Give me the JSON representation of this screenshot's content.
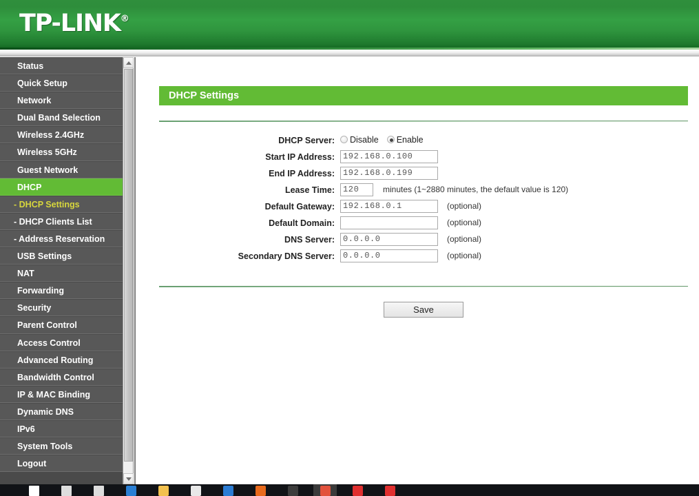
{
  "brand": {
    "name": "TP-LINK",
    "trademark": "®"
  },
  "sidebar": {
    "items": [
      {
        "label": "Status",
        "type": "main",
        "state": "normal"
      },
      {
        "label": "Quick Setup",
        "type": "main",
        "state": "normal"
      },
      {
        "label": "Network",
        "type": "main",
        "state": "normal"
      },
      {
        "label": "Dual Band Selection",
        "type": "main",
        "state": "normal"
      },
      {
        "label": "Wireless 2.4GHz",
        "type": "main",
        "state": "normal"
      },
      {
        "label": "Wireless 5GHz",
        "type": "main",
        "state": "normal"
      },
      {
        "label": "Guest Network",
        "type": "main",
        "state": "normal"
      },
      {
        "label": "DHCP",
        "type": "main",
        "state": "active"
      },
      {
        "label": "- DHCP Settings",
        "type": "sub",
        "state": "current"
      },
      {
        "label": "- DHCP Clients List",
        "type": "sub",
        "state": "normal"
      },
      {
        "label": "- Address Reservation",
        "type": "sub",
        "state": "normal"
      },
      {
        "label": "USB Settings",
        "type": "main",
        "state": "normal"
      },
      {
        "label": "NAT",
        "type": "main",
        "state": "normal"
      },
      {
        "label": "Forwarding",
        "type": "main",
        "state": "normal"
      },
      {
        "label": "Security",
        "type": "main",
        "state": "normal"
      },
      {
        "label": "Parent Control",
        "type": "main",
        "state": "normal"
      },
      {
        "label": "Access Control",
        "type": "main",
        "state": "normal"
      },
      {
        "label": "Advanced Routing",
        "type": "main",
        "state": "normal"
      },
      {
        "label": "Bandwidth Control",
        "type": "main",
        "state": "normal"
      },
      {
        "label": "IP & MAC Binding",
        "type": "main",
        "state": "normal"
      },
      {
        "label": "Dynamic DNS",
        "type": "main",
        "state": "normal"
      },
      {
        "label": "IPv6",
        "type": "main",
        "state": "normal"
      },
      {
        "label": "System Tools",
        "type": "main",
        "state": "normal"
      },
      {
        "label": "Logout",
        "type": "main",
        "state": "normal"
      }
    ]
  },
  "panel": {
    "title": "DHCP Settings"
  },
  "form": {
    "dhcp_server": {
      "label": "DHCP Server:",
      "options": [
        {
          "label": "Disable",
          "selected": false
        },
        {
          "label": "Enable",
          "selected": true
        }
      ]
    },
    "start_ip": {
      "label": "Start IP Address:",
      "value": "192.168.0.100",
      "placeholder": ""
    },
    "end_ip": {
      "label": "End IP Address:",
      "value": "192.168.0.199",
      "placeholder": ""
    },
    "lease_time": {
      "label": "Lease Time:",
      "value": "120",
      "hint": "minutes (1~2880 minutes, the default value is 120)"
    },
    "default_gateway": {
      "label": "Default Gateway:",
      "value": "192.168.0.1",
      "hint": "(optional)"
    },
    "default_domain": {
      "label": "Default Domain:",
      "value": "",
      "hint": "(optional)"
    },
    "dns_server": {
      "label": "DNS Server:",
      "value": "0.0.0.0",
      "hint": "(optional)"
    },
    "secondary_dns": {
      "label": "Secondary DNS Server:",
      "value": "0.0.0.0",
      "hint": "(optional)"
    }
  },
  "actions": {
    "save_label": "Save"
  },
  "colors": {
    "brand_green": "#62bb35",
    "header_green": "#2f8f3c",
    "sidebar_gray": "#585858",
    "sub_current_text": "#d8d73d"
  },
  "taskbar": {
    "icons": [
      {
        "name": "windows-start-icon",
        "color": "#ffffff"
      },
      {
        "name": "search-icon",
        "color": "#dddddd"
      },
      {
        "name": "task-view-icon",
        "color": "#dddddd"
      },
      {
        "name": "edge-browser-icon",
        "color": "#2a7fd4"
      },
      {
        "name": "file-explorer-icon",
        "color": "#f2c14e"
      },
      {
        "name": "microsoft-store-icon",
        "color": "#e8e8e8"
      },
      {
        "name": "office-icon",
        "color": "#2b7cd3"
      },
      {
        "name": "firefox-icon",
        "color": "#e86a1c"
      },
      {
        "name": "terminal-icon",
        "color": "#3c3c3c"
      },
      {
        "name": "chrome-icon",
        "color": "#e2523c"
      },
      {
        "name": "youtube-icon",
        "color": "#e02f2f"
      },
      {
        "name": "youtube-icon-2",
        "color": "#e02f2f"
      }
    ]
  }
}
